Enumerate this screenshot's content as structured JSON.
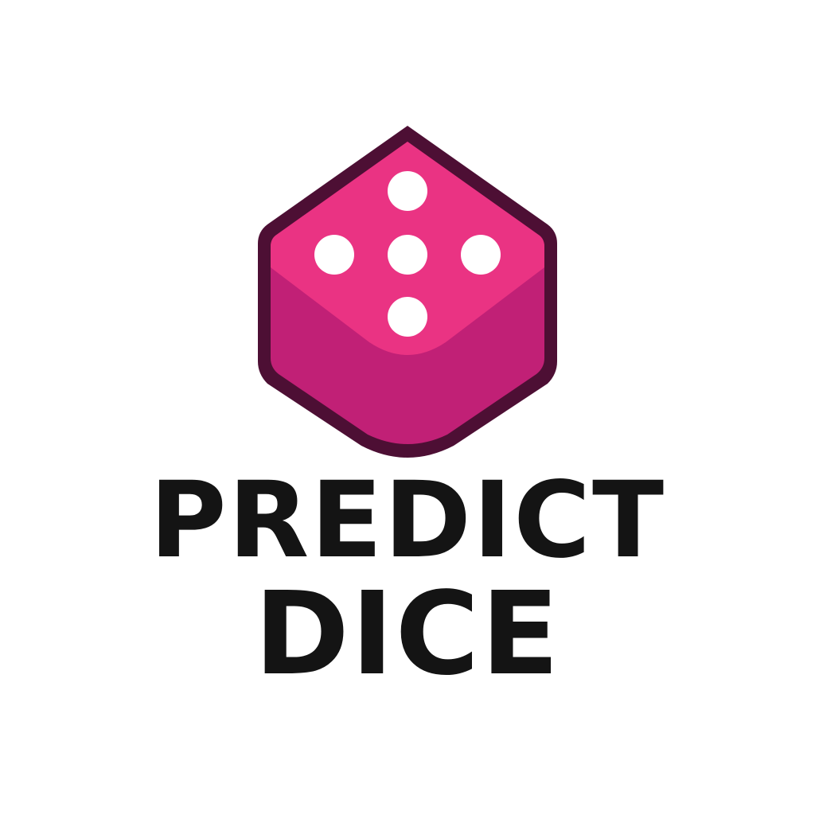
{
  "logo": {
    "icon": "dice-icon",
    "pip_icon": "dice-pip-icon",
    "face_value": 5,
    "wordmark_line_1": "PREDICT",
    "wordmark_line_2": "DICE"
  },
  "colors": {
    "background": "#ffffff",
    "dice_top": "#ea3383",
    "dice_bottom": "#c12076",
    "dice_outline": "#4d0f34",
    "pips": "#ffffff",
    "wordmark": "#141414"
  }
}
